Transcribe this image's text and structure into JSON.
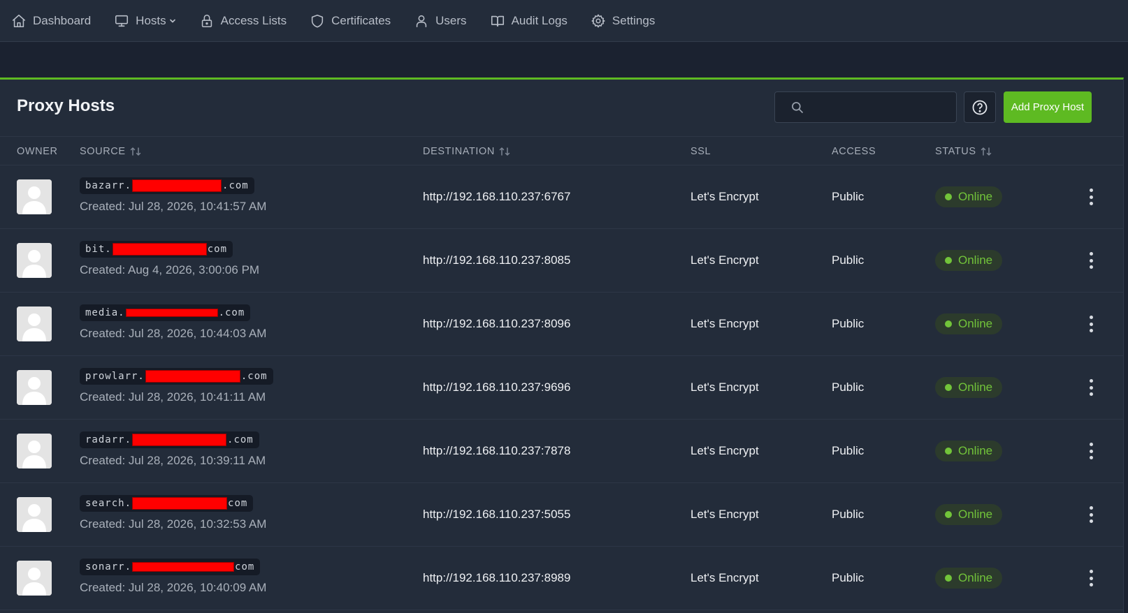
{
  "nav": [
    {
      "label": "Dashboard",
      "icon": "home-icon"
    },
    {
      "label": "Hosts",
      "icon": "monitor-icon",
      "has_dropdown": true
    },
    {
      "label": "Access Lists",
      "icon": "lock-icon"
    },
    {
      "label": "Certificates",
      "icon": "shield-icon"
    },
    {
      "label": "Users",
      "icon": "user-icon"
    },
    {
      "label": "Audit Logs",
      "icon": "book-icon"
    },
    {
      "label": "Settings",
      "icon": "gear-icon"
    }
  ],
  "colors": {
    "accent": "#5eba22",
    "online": "#72c43a",
    "background": "#1c2331",
    "card": "#232c3a",
    "redaction": "#ff0000"
  },
  "page": {
    "title": "Proxy Hosts",
    "search_placeholder": "",
    "help_icon": "help-circle-icon",
    "add_button": "Add Proxy Host"
  },
  "table": {
    "columns": {
      "owner": "OWNER",
      "source": "SOURCE",
      "destination": "DESTINATION",
      "ssl": "SSL",
      "access": "ACCESS",
      "status": "STATUS"
    },
    "rows": [
      {
        "source_prefix": "bazarr.",
        "source_suffix": ".com",
        "created": "Created: Jul 28, 2026, 10:41:57 AM",
        "destination": "http://192.168.110.237:6767",
        "ssl": "Let's Encrypt",
        "access": "Public",
        "status": "Online"
      },
      {
        "source_prefix": "bit.",
        "source_suffix": "com",
        "created": "Created: Aug 4, 2026, 3:00:06 PM",
        "destination": "http://192.168.110.237:8085",
        "ssl": "Let's Encrypt",
        "access": "Public",
        "status": "Online"
      },
      {
        "source_prefix": "media.",
        "source_suffix": ".com",
        "created": "Created: Jul 28, 2026, 10:44:03 AM",
        "destination": "http://192.168.110.237:8096",
        "ssl": "Let's Encrypt",
        "access": "Public",
        "status": "Online"
      },
      {
        "source_prefix": "prowlarr.",
        "source_suffix": ".com",
        "created": "Created: Jul 28, 2026, 10:41:11 AM",
        "destination": "http://192.168.110.237:9696",
        "ssl": "Let's Encrypt",
        "access": "Public",
        "status": "Online"
      },
      {
        "source_prefix": "radarr.",
        "source_suffix": ".com",
        "created": "Created: Jul 28, 2026, 10:39:11 AM",
        "destination": "http://192.168.110.237:7878",
        "ssl": "Let's Encrypt",
        "access": "Public",
        "status": "Online"
      },
      {
        "source_prefix": "search.",
        "source_suffix": "com",
        "created": "Created: Jul 28, 2026, 10:32:53 AM",
        "destination": "http://192.168.110.237:5055",
        "ssl": "Let's Encrypt",
        "access": "Public",
        "status": "Online"
      },
      {
        "source_prefix": "sonarr.",
        "source_suffix": "com",
        "created": "Created: Jul 28, 2026, 10:40:09 AM",
        "destination": "http://192.168.110.237:8989",
        "ssl": "Let's Encrypt",
        "access": "Public",
        "status": "Online"
      }
    ]
  }
}
